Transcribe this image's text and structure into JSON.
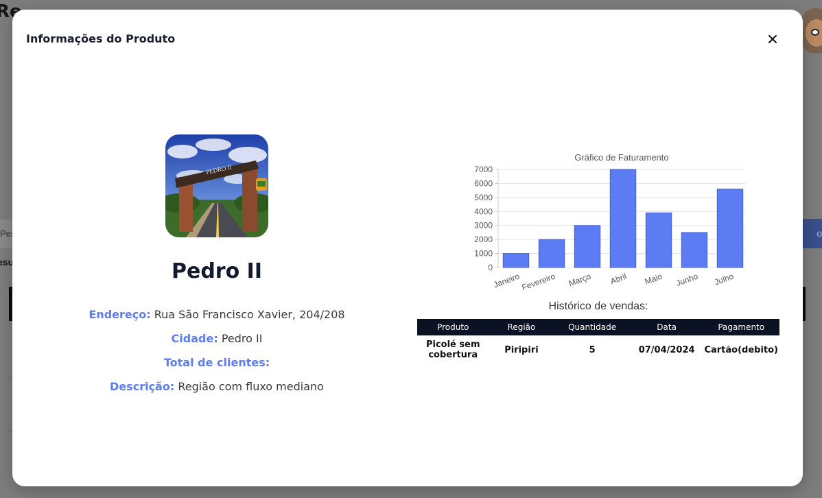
{
  "background": {
    "title_fragment": "Re",
    "search_fragment": "Pes",
    "results_fragment": "esu",
    "button_fragment": "o"
  },
  "modal": {
    "title": "Informações do Produto",
    "close_icon": "close-icon"
  },
  "product": {
    "image": "product-photo (road under arched gateway)",
    "name": "Pedro II",
    "address_label": "Endereço:",
    "address_value": "Rua São Francisco Xavier, 204/208",
    "city_label": "Cidade:",
    "city_value": "Pedro II",
    "clients_label": "Total de clientes:",
    "clients_value": "",
    "description_label": "Descrição:",
    "description_value": "Região com fluxo mediano"
  },
  "chart_data": {
    "type": "bar",
    "title": "Gráfico de Faturamento",
    "categories": [
      "Janeiro",
      "Fevereiro",
      "Março",
      "Abril",
      "Maio",
      "Junho",
      "Julho"
    ],
    "values": [
      1000,
      2000,
      3000,
      7000,
      3900,
      2500,
      5600
    ],
    "ylim": [
      0,
      7000
    ],
    "yticks": [
      0,
      1000,
      2000,
      3000,
      4000,
      5000,
      6000,
      7000
    ],
    "grid": true,
    "bar_color": "#5b7cf3"
  },
  "sales": {
    "title": "Histórico de vendas:",
    "columns": [
      "Produto",
      "Região",
      "Quantidade",
      "Data",
      "Pagamento"
    ],
    "rows": [
      [
        "Picolé sem cobertura",
        "Piripiri",
        "5",
        "07/04/2024",
        "Cartão(debito)"
      ]
    ]
  }
}
